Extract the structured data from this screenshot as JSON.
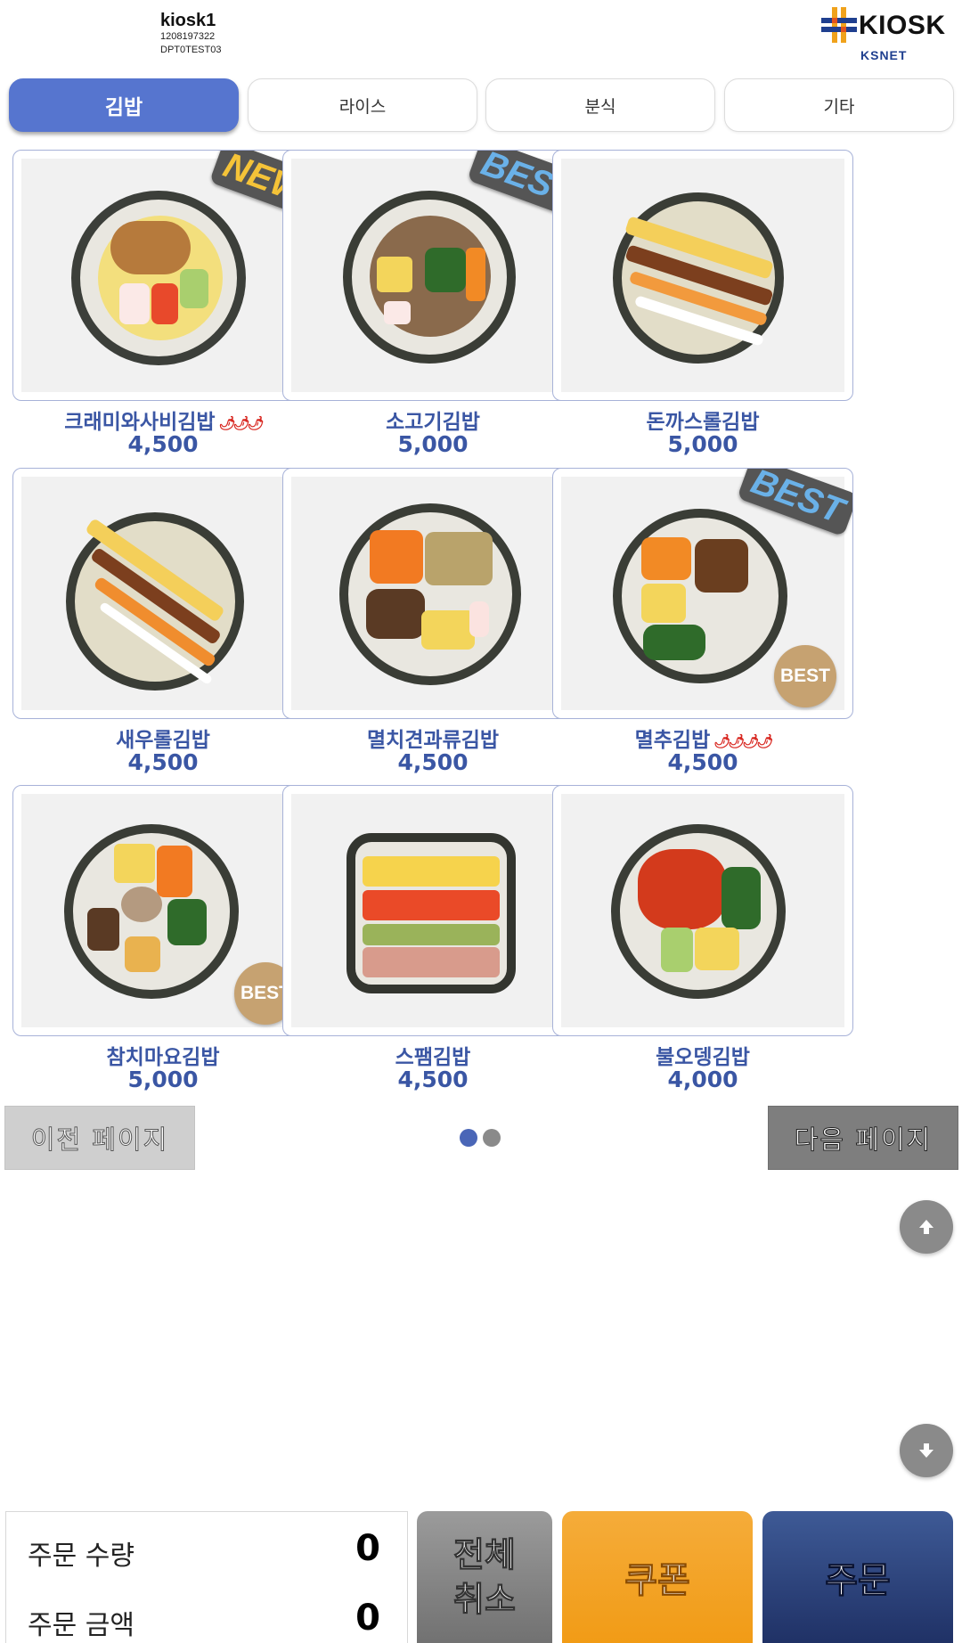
{
  "header": {
    "kiosk_name": "kiosk1",
    "kiosk_code": "1208197322",
    "device_id": "DPT0TEST03",
    "logo_text": "KIOSK",
    "logo_sub": "KSNET"
  },
  "tabs": [
    {
      "label": "김밥",
      "active": true
    },
    {
      "label": "라이스",
      "active": false
    },
    {
      "label": "분식",
      "active": false
    },
    {
      "label": "기타",
      "active": false
    }
  ],
  "menu_items": [
    {
      "name": "크래미와사비김밥",
      "price": "4,500",
      "flag_badge": "NEW",
      "spicy": "🌶🌶🌶"
    },
    {
      "name": "소고기김밥",
      "price": "5,000",
      "flag_badge": "BEST"
    },
    {
      "name": "돈까스롤김밥",
      "price": "5,000"
    },
    {
      "name": "새우롤김밥",
      "price": "4,500"
    },
    {
      "name": "멸치견과류김밥",
      "price": "4,500"
    },
    {
      "name": "멸추김밥",
      "price": "4,500",
      "flag_badge": "BEST",
      "circle_badge": "BEST",
      "spicy": "🌶🌶🌶🌶"
    },
    {
      "name": "참치마요김밥",
      "price": "5,000",
      "circle_badge": "BEST"
    },
    {
      "name": "스팸김밥",
      "price": "4,500"
    },
    {
      "name": "불오뎅김밥",
      "price": "4,000"
    }
  ],
  "pagination": {
    "prev_label": "이전 페이지",
    "next_label": "다음 페이지",
    "current_page": 1,
    "total_pages": 2
  },
  "summary": {
    "quantity_label": "주문 수량",
    "quantity_value": "0",
    "amount_label": "주문 금액",
    "amount_value": "0"
  },
  "actions": {
    "cancel_all_line1": "전체",
    "cancel_all_line2": "취소",
    "coupon": "쿠폰",
    "order": "주문"
  },
  "colors": {
    "accent": "#5675cf",
    "text_blue": "#3a56a4",
    "coupon": "#f19a13",
    "order": "#1d2e62"
  }
}
